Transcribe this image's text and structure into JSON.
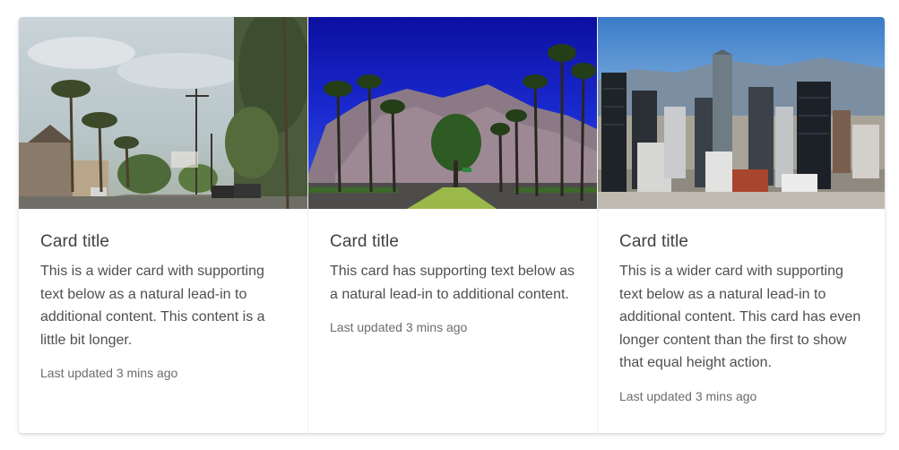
{
  "cards": [
    {
      "image": "palm-street-photo",
      "title": "Card title",
      "text": "This is a wider card with supporting text below as a natural lead-in to additional content. This content is a little bit longer.",
      "footnote": "Last updated 3 mins ago"
    },
    {
      "image": "desert-mountain-road-photo",
      "title": "Card title",
      "text": "This card has supporting text below as a natural lead-in to additional content.",
      "footnote": "Last updated 3 mins ago"
    },
    {
      "image": "city-skyline-photo",
      "title": "Card title",
      "text": "This is a wider card with supporting text below as a natural lead-in to additional content. This card has even longer content than the first to show that equal height action.",
      "footnote": "Last updated 3 mins ago"
    }
  ]
}
